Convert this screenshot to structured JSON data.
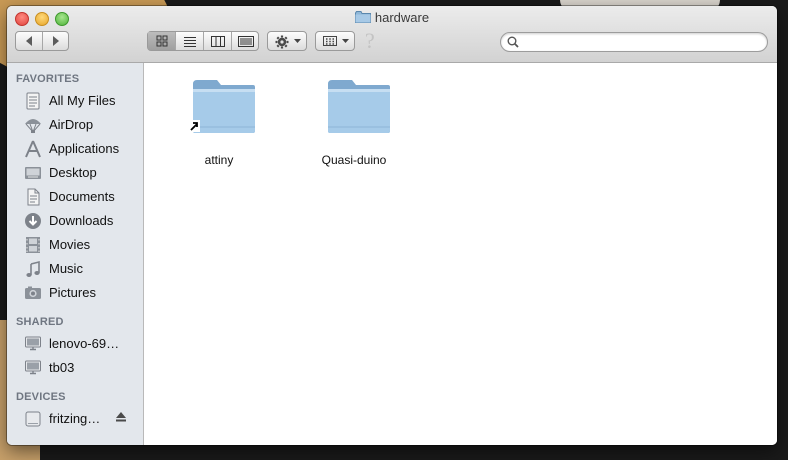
{
  "window": {
    "title": "hardware"
  },
  "toolbar": {
    "view_modes": [
      "icon-view",
      "list-view",
      "column-view",
      "cover-flow-view"
    ],
    "action_menu": "gear-icon",
    "arrange_menu": "arrange-icon",
    "help_icon": "?",
    "search": {
      "value": "",
      "placeholder": ""
    }
  },
  "sidebar": {
    "sections": [
      {
        "header": "FAVORITES",
        "items": [
          {
            "label": "All My Files",
            "icon": "all-my-files-icon"
          },
          {
            "label": "AirDrop",
            "icon": "airdrop-icon"
          },
          {
            "label": "Applications",
            "icon": "applications-icon"
          },
          {
            "label": "Desktop",
            "icon": "desktop-icon"
          },
          {
            "label": "Documents",
            "icon": "documents-icon"
          },
          {
            "label": "Downloads",
            "icon": "downloads-icon"
          },
          {
            "label": "Movies",
            "icon": "movies-icon"
          },
          {
            "label": "Music",
            "icon": "music-icon"
          },
          {
            "label": "Pictures",
            "icon": "pictures-icon"
          }
        ]
      },
      {
        "header": "SHARED",
        "items": [
          {
            "label": "lenovo-69…",
            "icon": "computer-icon"
          },
          {
            "label": "tb03",
            "icon": "computer-icon"
          }
        ]
      },
      {
        "header": "DEVICES",
        "items": [
          {
            "label": "fritzing…",
            "icon": "disk-icon"
          }
        ]
      }
    ]
  },
  "content": {
    "items": [
      {
        "name": "attiny",
        "type": "folder",
        "alias": true
      },
      {
        "name": "Quasi-duino",
        "type": "folder",
        "alias": false
      }
    ]
  }
}
